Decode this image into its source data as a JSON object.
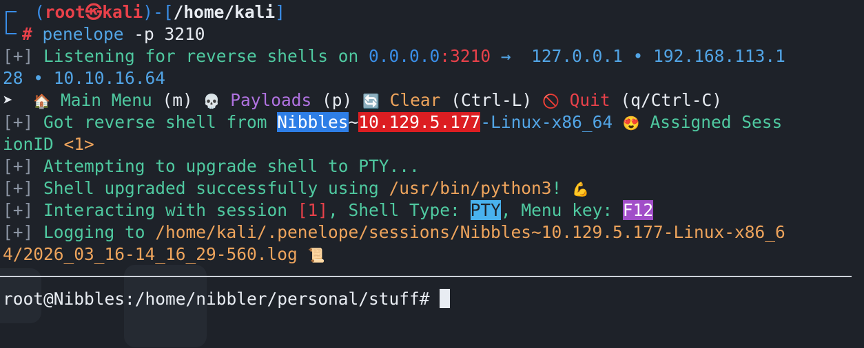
{
  "prompt": {
    "open_paren": "(",
    "user": "root",
    "at_symbol": "㉿",
    "host": "kali",
    "close_paren": ")",
    "dash_bracket_open": "-[",
    "path": "/home/kali",
    "dash_bracket_close": "]",
    "hash": "#",
    "command": "penelope",
    "args": " -p 3210"
  },
  "listen": {
    "tag": "[+]",
    "text": " Listening for reverse shells on ",
    "bind_ip": "0.0.0.0",
    "colon": ":",
    "port": "3210",
    "arrow": " →  ",
    "ip1": "127.0.0.1",
    "sep1": " • ",
    "ip2_part1": "192.168.113.1",
    "ip2_part2": "28",
    "sep2": " • ",
    "ip3": "10.10.16.64"
  },
  "menu": {
    "pointer": "➤",
    "home_icon": "🏠",
    "main_menu_label": "Main Menu",
    "main_menu_key": "(m)",
    "payloads_icon": "💀",
    "payloads_label": "Payloads",
    "payloads_key": "(p)",
    "clear_icon": "🔄",
    "clear_label": "Clear",
    "clear_key": "(Ctrl-L)",
    "quit_icon": "🚫",
    "quit_label": "Quit",
    "quit_key": "(q/Ctrl-C)"
  },
  "got_shell": {
    "tag": "[+]",
    "text": " Got reverse shell from ",
    "host": "Nibbles",
    "tilde": "~",
    "ip": "10.129.5.177",
    "platform": "-Linux-x86_64",
    "emoji": "😍",
    "assigned_part1": " Assigned Sess",
    "assigned_part2": "ionID ",
    "session_id": "<1>"
  },
  "attempt": {
    "tag": "[+]",
    "text": " Attempting to upgrade shell to PTY..."
  },
  "upgraded": {
    "tag": "[+]",
    "text": " Shell upgraded successfully using ",
    "binary": "/usr/bin/python3",
    "bang": "!",
    "emoji": "💪"
  },
  "interacting": {
    "tag": "[+]",
    "text": " Interacting with session ",
    "session": "[1]",
    "shell_type_label": ", Shell Type: ",
    "shell_type": "PTY",
    "menu_key_label": ", Menu key: ",
    "menu_key": "F12"
  },
  "logging": {
    "tag": "[+]",
    "text": " Logging to ",
    "path_part1": "/home/kali/.penelope/sessions/Nibbles~10.129.5.177-Linux-x86_6",
    "path_part2": "4/2026_03_16-14_16_29-560.log",
    "emoji": "📜"
  },
  "shell_prompt": {
    "text": "root@Nibbles:/home/nibbler/personal/stuff# "
  },
  "colors": {
    "background": "#1e2229",
    "blue": "#3a8ee8",
    "red": "#e8414a",
    "green": "#4fc9a0",
    "orange": "#eea45c",
    "purple": "#b072e0"
  }
}
